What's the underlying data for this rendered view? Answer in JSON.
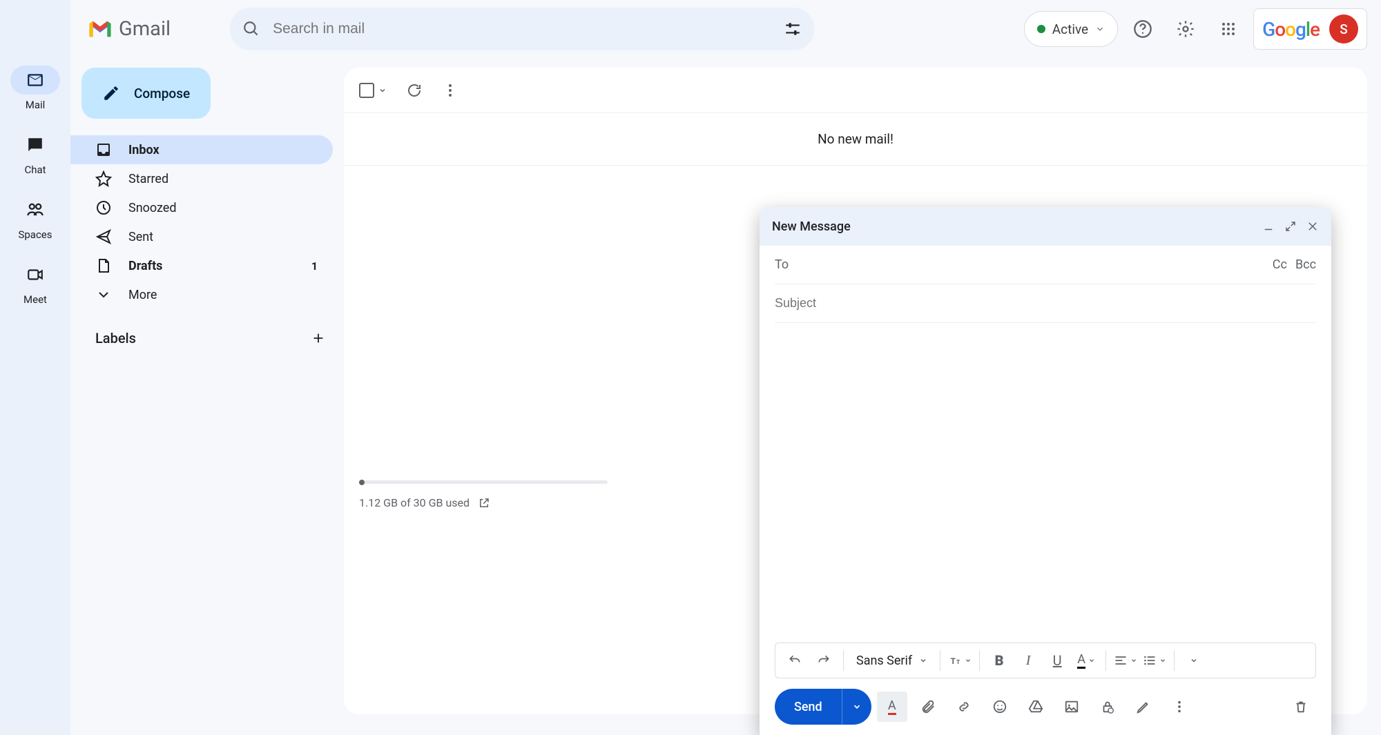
{
  "header": {
    "app_name": "Gmail",
    "search_placeholder": "Search in mail",
    "status_label": "Active",
    "avatar_letter": "S"
  },
  "rail": {
    "items": [
      {
        "label": "Mail",
        "icon": "mail",
        "selected": true
      },
      {
        "label": "Chat",
        "icon": "chat",
        "selected": false
      },
      {
        "label": "Spaces",
        "icon": "spaces",
        "selected": false
      },
      {
        "label": "Meet",
        "icon": "meet",
        "selected": false
      }
    ]
  },
  "sidebar": {
    "compose_label": "Compose",
    "folders": [
      {
        "label": "Inbox",
        "selected": true,
        "bold": true,
        "count": ""
      },
      {
        "label": "Starred",
        "selected": false,
        "bold": false,
        "count": ""
      },
      {
        "label": "Snoozed",
        "selected": false,
        "bold": false,
        "count": ""
      },
      {
        "label": "Sent",
        "selected": false,
        "bold": false,
        "count": ""
      },
      {
        "label": "Drafts",
        "selected": false,
        "bold": true,
        "count": "1"
      },
      {
        "label": "More",
        "selected": false,
        "bold": false,
        "count": ""
      }
    ],
    "labels_title": "Labels"
  },
  "main": {
    "empty_message": "No new mail!",
    "storage_text": "1.12 GB of 30 GB used"
  },
  "compose": {
    "title": "New Message",
    "to_label": "To",
    "cc_label": "Cc",
    "bcc_label": "Bcc",
    "subject_placeholder": "Subject",
    "font_name": "Sans Serif",
    "send_label": "Send"
  }
}
